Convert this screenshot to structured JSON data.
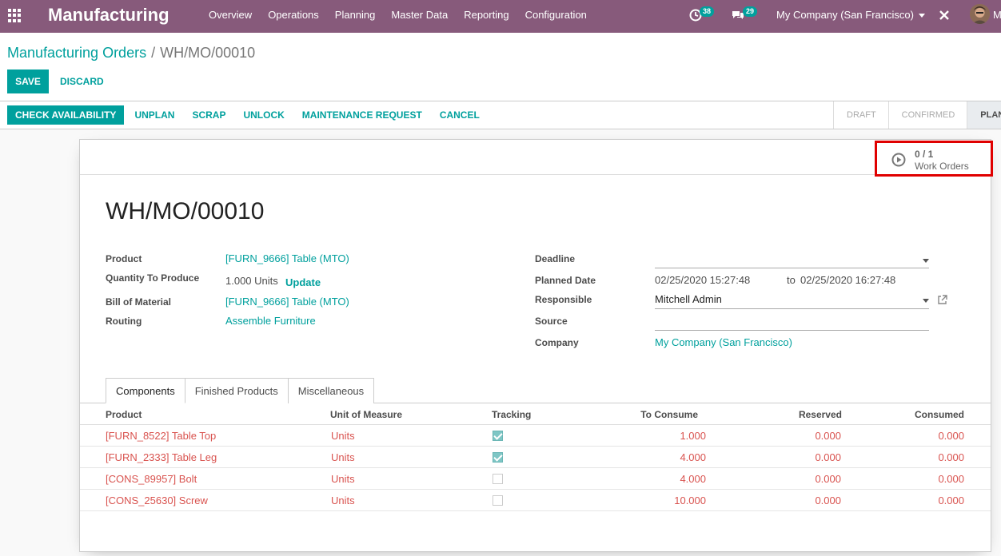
{
  "navbar": {
    "app_title": "Manufacturing",
    "menu": [
      "Overview",
      "Operations",
      "Planning",
      "Master Data",
      "Reporting",
      "Configuration"
    ],
    "activity_count": "38",
    "messages_count": "29",
    "company": "My Company (San Francisco)",
    "user_initial": "M"
  },
  "breadcrumb": {
    "parent": "Manufacturing Orders",
    "separator": "/",
    "current": "WH/MO/00010"
  },
  "actions": {
    "save": "SAVE",
    "discard": "DISCARD"
  },
  "statusbar": {
    "buttons": [
      "CHECK AVAILABILITY",
      "UNPLAN",
      "SCRAP",
      "UNLOCK",
      "MAINTENANCE REQUEST",
      "CANCEL"
    ],
    "stages": [
      "DRAFT",
      "CONFIRMED",
      "PLANN"
    ],
    "active_stage": "PLANN"
  },
  "smart_button": {
    "count": "0 / 1",
    "label": "Work Orders",
    "icon": "play-circle-icon"
  },
  "record": {
    "title": "WH/MO/00010",
    "left": {
      "product_label": "Product",
      "product_value": "[FURN_9666] Table (MTO)",
      "qty_label": "Quantity To Produce",
      "qty_value": "1.000 Units",
      "update_label": "Update",
      "bom_label": "Bill of Material",
      "bom_value": "[FURN_9666] Table (MTO)",
      "routing_label": "Routing",
      "routing_value": "Assemble Furniture"
    },
    "right": {
      "deadline_label": "Deadline",
      "deadline_value": "",
      "planned_label": "Planned Date",
      "planned_from": "02/25/2020 15:27:48",
      "planned_to_word": "to",
      "planned_to": "02/25/2020 16:27:48",
      "responsible_label": "Responsible",
      "responsible_value": "Mitchell Admin",
      "source_label": "Source",
      "source_value": "",
      "company_label": "Company",
      "company_value": "My Company (San Francisco)"
    }
  },
  "tabs": [
    "Components",
    "Finished Products",
    "Miscellaneous"
  ],
  "table": {
    "headers": [
      "Product",
      "Unit of Measure",
      "Tracking",
      "To Consume",
      "Reserved",
      "Consumed"
    ],
    "rows": [
      {
        "product": "[FURN_8522] Table Top",
        "uom": "Units",
        "tracking": true,
        "to_consume": "1.000",
        "reserved": "0.000",
        "consumed": "0.000"
      },
      {
        "product": "[FURN_2333] Table Leg",
        "uom": "Units",
        "tracking": true,
        "to_consume": "4.000",
        "reserved": "0.000",
        "consumed": "0.000"
      },
      {
        "product": "[CONS_89957] Bolt",
        "uom": "Units",
        "tracking": false,
        "to_consume": "4.000",
        "reserved": "0.000",
        "consumed": "0.000"
      },
      {
        "product": "[CONS_25630] Screw",
        "uom": "Units",
        "tracking": false,
        "to_consume": "10.000",
        "reserved": "0.000",
        "consumed": "0.000"
      }
    ]
  },
  "colors": {
    "navbar": "#875a7b",
    "accent": "#00a09d",
    "row_text": "#d9534f",
    "highlight_border": "#e00000"
  }
}
